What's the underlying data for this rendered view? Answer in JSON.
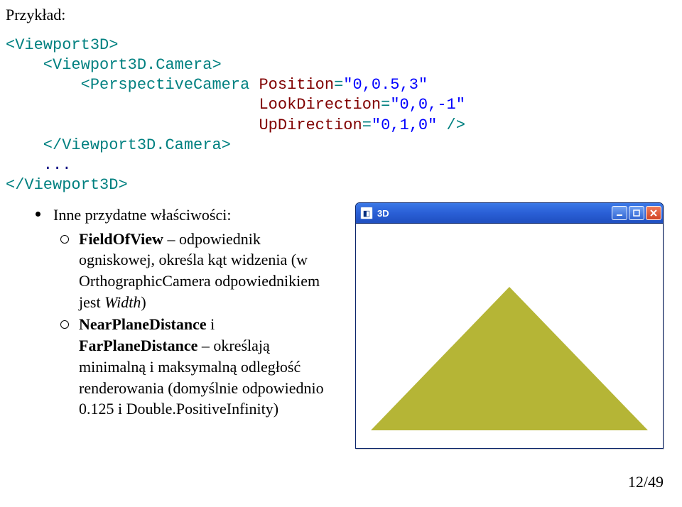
{
  "heading": "Przykład:",
  "code": {
    "l1a": "<",
    "l1b": "Viewport3D",
    "l1c": ">",
    "l2a": "    <",
    "l2b": "Viewport3D.Camera",
    "l2c": ">",
    "l3a": "        <",
    "l3b": "PerspectiveCamera",
    "l3c": " ",
    "l3d": "Position",
    "l3e": "=",
    "l3f": "\"0,0.5,3\"",
    "l4sp": "                           ",
    "l4a": "LookDirection",
    "l4b": "=",
    "l4c": "\"0,0,-1\"",
    "l5sp": "                           ",
    "l5a": "UpDirection",
    "l5b": "=",
    "l5c": "\"0,1,0\"",
    "l5d": " />",
    "l6a": "    </",
    "l6b": "Viewport3D.Camera",
    "l6c": ">",
    "l7": "    ...",
    "l8a": "</",
    "l8b": "Viewport3D",
    "l8c": ">"
  },
  "bullets": {
    "outer": "Inne przydatne właściwości:",
    "inner1_bold1": "FieldOfView",
    "inner1_text1": " – odpowiednik ogniskowej, określa kąt widzenia (w OrthographicCamera odpowiednikiem jest ",
    "inner1_italic": "Width",
    "inner1_text2": ")",
    "inner2_bold1": "NearPlaneDistance",
    "inner2_text1": " i ",
    "inner2_bold2": "FarPlaneDistance",
    "inner2_text2": " – określają minimalną i maksymalną odległość renderowania (domyślnie odpowiednio 0.125 i Double.PositiveInfinity)"
  },
  "window": {
    "title": "3D"
  },
  "page": "12/49"
}
